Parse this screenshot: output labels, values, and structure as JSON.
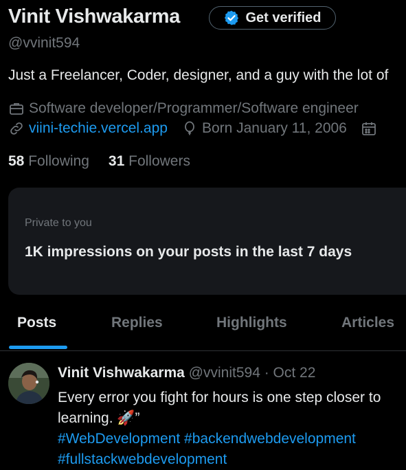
{
  "profile": {
    "name": "Vinit Vishwakarma",
    "verify_label": "Get verified",
    "handle": "@vvinit594",
    "bio": "Just a Freelancer, Coder, designer, and a guy with the lot of",
    "category": "Software developer/Programmer/Software engineer",
    "website": "viini-techie.vercel.app",
    "born": "Born January 11, 2006",
    "following_count": "58",
    "following_label": "Following",
    "followers_count": "31",
    "followers_label": "Followers"
  },
  "insights": {
    "kicker": "Private to you",
    "text": "1K impressions on your posts in the last 7 days"
  },
  "tabs": {
    "posts": "Posts",
    "replies": "Replies",
    "highlights": "Highlights",
    "articles": "Articles"
  },
  "tweet": {
    "author_name": "Vinit Vishwakarma",
    "author_handle_date": "@vvinit594 · Oct 22",
    "line1": "Every error you fight for hours is one step closer to",
    "line2": "learning. 🚀”",
    "hashtags_line": "#WebDevelopment #backendwebdevelopment",
    "hashtags_line2": "#fullstackwebdevelopment"
  },
  "colors": {
    "background": "#000000",
    "text": "#e7e9ea",
    "muted": "#71767b",
    "accent": "#1d9bf0",
    "card": "#16181c"
  },
  "icons": {
    "verified": "verified-badge-icon",
    "category": "briefcase-icon",
    "website": "link-icon",
    "born": "balloon-icon",
    "joined": "calendar-icon"
  }
}
